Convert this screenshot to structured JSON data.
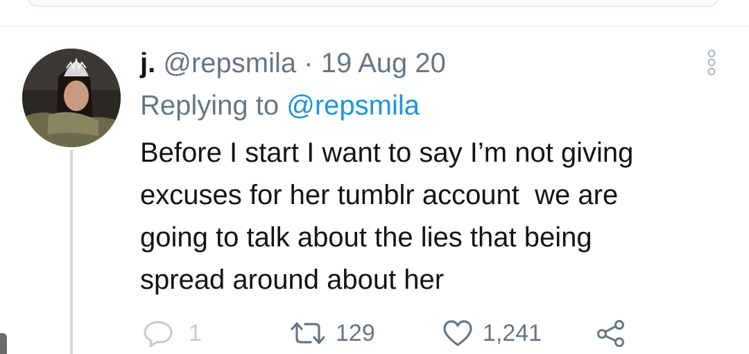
{
  "tweet": {
    "display_name": "j.",
    "handle": "@repsmila",
    "separator": "·",
    "date": "19 Aug 20",
    "replying_prefix": "Replying to",
    "replying_to": "@repsmila",
    "text": "Before I start I want to say I’m not giving\nexcuses for her tumblr account  we are\ngoing to talk about the lies that being\nspread around about her"
  },
  "actions": {
    "replies": "1",
    "retweets": "129",
    "likes": "1,241"
  },
  "icons": {
    "more": "more-vertical-icon",
    "reply": "reply-icon",
    "retweet": "retweet-icon",
    "like": "heart-icon",
    "share": "share-icon"
  },
  "colors": {
    "text": "#0f1419",
    "secondary": "#657786",
    "link": "#1b95e0",
    "thread_line": "#cfd9de"
  }
}
